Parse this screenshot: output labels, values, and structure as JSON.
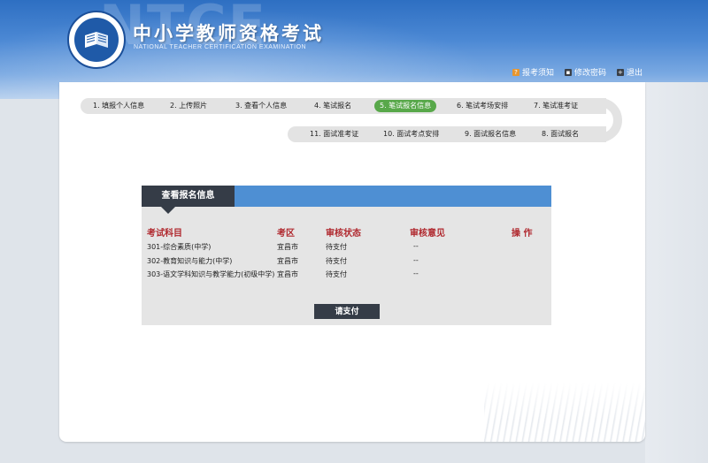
{
  "header": {
    "watermark": "NTCE",
    "title": "中小学教师资格考试",
    "subtitle": "NATIONAL TEACHER CERTIFICATION EXAMINATION",
    "links": [
      {
        "label": "报考须知",
        "icon": "question-icon",
        "color": "#e8962e"
      },
      {
        "label": "修改密码",
        "icon": "key-icon",
        "color": "#3a3f47"
      },
      {
        "label": "退出",
        "icon": "plus-icon",
        "color": "#3a3f47"
      }
    ]
  },
  "steps": {
    "row1": [
      "1. 填报个人信息",
      "2. 上传照片",
      "3. 查看个人信息",
      "4. 笔试报名",
      "5. 笔试报名信息",
      "6. 笔试考场安排",
      "7. 笔试准考证"
    ],
    "row2": [
      "11. 面试准考证",
      "10. 面试考点安排",
      "9. 面试报名信息",
      "8. 面试报名"
    ],
    "active": "5. 笔试报名信息",
    "active_color": "#58a84a"
  },
  "info": {
    "title": "查看报名信息",
    "columns": [
      "考试科目",
      "考区",
      "审核状态",
      "审核意见",
      "操 作"
    ],
    "rows": [
      {
        "subject": "301-综合素质(中学)",
        "area": "宜昌市",
        "status": "待支付",
        "opinion": "--",
        "action": ""
      },
      {
        "subject": "302-教育知识与能力(中学)",
        "area": "宜昌市",
        "status": "待支付",
        "opinion": "--",
        "action": ""
      },
      {
        "subject": "303-语文学科知识与教学能力(初级中学)",
        "area": "宜昌市",
        "status": "待支付",
        "opinion": "--",
        "action": ""
      }
    ],
    "pay_button": "请支付"
  }
}
